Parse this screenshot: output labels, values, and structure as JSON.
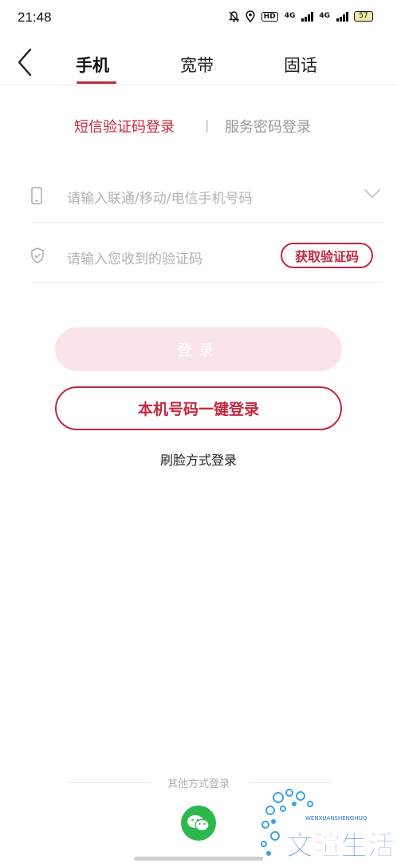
{
  "status_bar": {
    "time": "21:48",
    "hd_label": "HD",
    "net1": "4G",
    "net2": "4G",
    "battery": "57"
  },
  "nav": {
    "back_icon": "chevron-left-icon",
    "tabs": [
      {
        "label": "手机",
        "active": true
      },
      {
        "label": "宽带",
        "active": false
      },
      {
        "label": "固话",
        "active": false
      }
    ]
  },
  "login_mode": {
    "sms": "短信验证码登录",
    "separator": "|",
    "password": "服务密码登录"
  },
  "form": {
    "phone_placeholder": "请输入联通/移动/电信手机号码",
    "code_placeholder": "请输入您收到的验证码",
    "get_code_label": "获取验证码"
  },
  "buttons": {
    "login": "登录",
    "one_key_login": "本机号码一键登录",
    "face_login": "刷脸方式登录"
  },
  "other": {
    "label": "其他方式登录",
    "wechat_icon": "wechat-icon"
  },
  "watermark": {
    "text": "文暄生活",
    "sub": "WENXUANSHENGHUO"
  },
  "colors": {
    "accent": "#c3283e",
    "disabled_button": "#fbe4e7",
    "wechat": "#2db84d"
  }
}
